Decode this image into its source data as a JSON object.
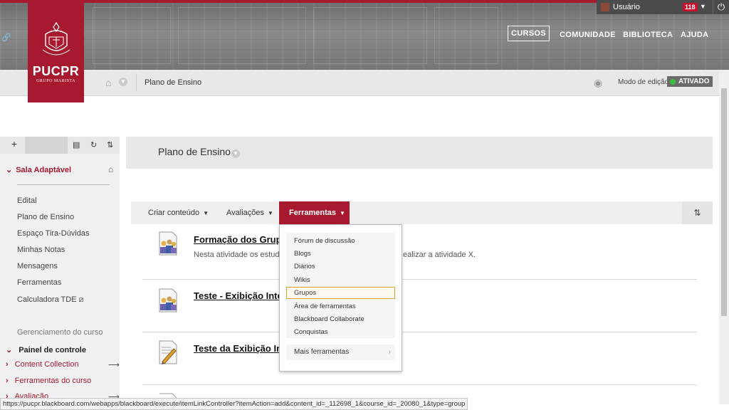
{
  "header": {
    "brand": "PUCPR",
    "brand_sub": "GRUPO MARISTA",
    "user": {
      "name": "Usuário",
      "notifications": "118"
    },
    "nav": [
      {
        "label": "CURSOS",
        "active": true
      },
      {
        "label": "COMUNIDADE"
      },
      {
        "label": "BIBLIOTECA"
      },
      {
        "label": "AJUDA"
      }
    ]
  },
  "breadcrumb": {
    "current": "Plano de Ensino",
    "edit_mode_label": "Modo de edição",
    "edit_mode_value": "ATIVADO"
  },
  "sidebar": {
    "course_name": "Sala Adaptável",
    "items": [
      {
        "label": "Edital"
      },
      {
        "label": "Plano de Ensino"
      },
      {
        "label": "Espaço Tira-Dúvidas"
      },
      {
        "label": "Minhas Notas"
      },
      {
        "label": "Mensagens"
      },
      {
        "label": "Ferramentas"
      },
      {
        "label": "Calculadora TDE ⧄"
      }
    ],
    "management_heading": "Gerenciamento do curso",
    "control_panel": "Painel de controle",
    "control_items": [
      {
        "label": "Content Collection"
      },
      {
        "label": "Ferramentas do curso"
      },
      {
        "label": "Avaliação"
      }
    ]
  },
  "page": {
    "title": "Plano de Ensino"
  },
  "actionbar": {
    "create": "Criar conteúdo",
    "assessments": "Avaliações",
    "tools": "Ferramentas"
  },
  "tools_menu": {
    "items": [
      {
        "label": "Fórum de discussão"
      },
      {
        "label": "Blogs"
      },
      {
        "label": "Diários"
      },
      {
        "label": "Wikis"
      },
      {
        "label": "Grupos",
        "highlighted": true
      },
      {
        "label": "Área de ferramentas"
      },
      {
        "label": "Blackboard Collaborate"
      },
      {
        "label": "Conquistas"
      }
    ],
    "more": "Mais ferramentas"
  },
  "content": {
    "items": [
      {
        "title": "Formação dos Grupos",
        "desc_a": "Nesta atividade os estudan",
        "desc_b": "ealizar a atividade X."
      },
      {
        "title": "Teste - Exibição Intelig"
      },
      {
        "title": "Teste da Exibição Intel"
      }
    ]
  },
  "status_url": "https://pucpr.blackboard.com/webapps/blackboard/execute/itemLinkController?itemAction=add&content_id=_112698_1&course_id=_20080_1&type=group",
  "colors": {
    "brand_red": "#a6192e",
    "edit_on_green": "#35c23a"
  }
}
